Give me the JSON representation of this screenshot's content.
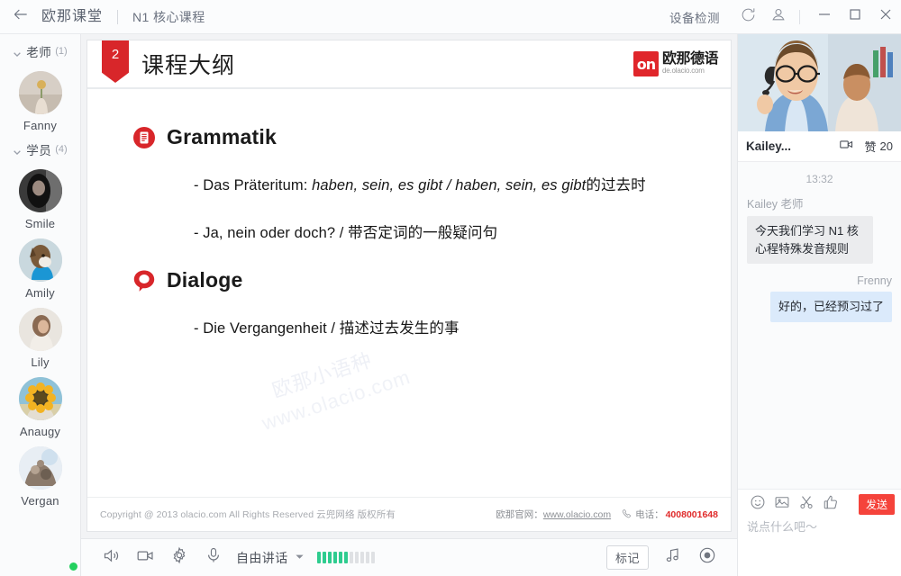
{
  "titlebar": {
    "back_icon": "arrow-left-icon",
    "app_title": "欧那课堂",
    "course_title": "N1 核心课程",
    "device_check": "设备检测",
    "refresh_icon": "refresh-icon",
    "user_icon": "user-camera-icon",
    "minimize": "—",
    "maximize": "□",
    "close": "×"
  },
  "sidebar": {
    "groups": [
      {
        "name": "老师",
        "count": "(1)",
        "members": [
          {
            "name": "Fanny",
            "online": false,
            "avatar_kind": "flower-hand"
          }
        ]
      },
      {
        "name": "学员",
        "count": "(4)",
        "members": [
          {
            "name": "Smile",
            "online": true,
            "avatar_kind": "woman-bw"
          },
          {
            "name": "Amily",
            "online": false,
            "avatar_kind": "dog"
          },
          {
            "name": "Lily",
            "online": false,
            "avatar_kind": "woman-profile"
          },
          {
            "name": "Anaugy",
            "online": false,
            "avatar_kind": "sunflower"
          },
          {
            "name": "Vergan",
            "online": false,
            "avatar_kind": "rocks"
          }
        ]
      }
    ]
  },
  "slide": {
    "page_number": "2",
    "title": "课程大纲",
    "logo_mark": "on",
    "logo_cn": "欧那德语",
    "logo_url": "de.olacio.com",
    "watermark_line1": "欧那小语种",
    "watermark_line2": "www.olacio.com",
    "sections": [
      {
        "icon": "document-icon",
        "heading": "Grammatik",
        "bullets": [
          {
            "prefix": "-  Das Präteritum: ",
            "italic": "haben, sein, es gibt / haben, sein, es gibt",
            "suffix": "的过去时"
          },
          {
            "prefix": "-  Ja, nein oder doch? / 带否定词的一般疑问句",
            "italic": "",
            "suffix": ""
          }
        ]
      },
      {
        "icon": "speech-bubble-icon",
        "heading": "Dialoge",
        "bullets": [
          {
            "prefix": "-  Die Vergangenheit / 描述过去发生的事",
            "italic": "",
            "suffix": ""
          }
        ]
      }
    ],
    "footer": {
      "copyright": "Copyright @ 2013 olacio.com All Rights Reserved 云兜网络 版权所有",
      "site_label": "欧那官网：",
      "site_url": "www.olacio.com",
      "phone_label": "电话：",
      "phone_number": "4008001648"
    }
  },
  "toolbar": {
    "speaker_icon": "speaker-icon",
    "camera_icon": "camera-icon",
    "settings_icon": "gear-icon",
    "mic_icon": "microphone-icon",
    "speak_mode": "自由讲话",
    "caret_icon": "chevron-down-icon",
    "meter_total": 11,
    "meter_active": 6,
    "mark_label": "标记",
    "music_icon": "music-note-icon",
    "record_icon": "record-icon"
  },
  "right_panel": {
    "video": {
      "alt": "teacher-video-feed"
    },
    "teacher_name": "Kailey...",
    "camera_icon": "video-camera-icon",
    "like_label": "赞",
    "like_count": "20",
    "chat": {
      "time": "13:32",
      "messages": [
        {
          "side": "left",
          "sender": "Kailey 老师",
          "text": "今天我们学习 N1 核心程特殊发音规则"
        },
        {
          "side": "right",
          "sender": "Frenny",
          "text": "好的，已经预习过了"
        }
      ]
    },
    "composer": {
      "emoji_icon": "emoji-icon",
      "image_icon": "image-icon",
      "scissors_icon": "scissors-icon",
      "thumbup_icon": "thumbs-up-icon",
      "send_label": "发送",
      "input_value": "",
      "input_placeholder": "说点什么吧～"
    }
  },
  "colors": {
    "brand_red": "#d8262a",
    "send_red": "#f5433b",
    "online_green": "#23d05e",
    "meter_green": "#2ecc8f",
    "self_bubble": "#dbeafb",
    "other_bubble": "#ebecee"
  }
}
